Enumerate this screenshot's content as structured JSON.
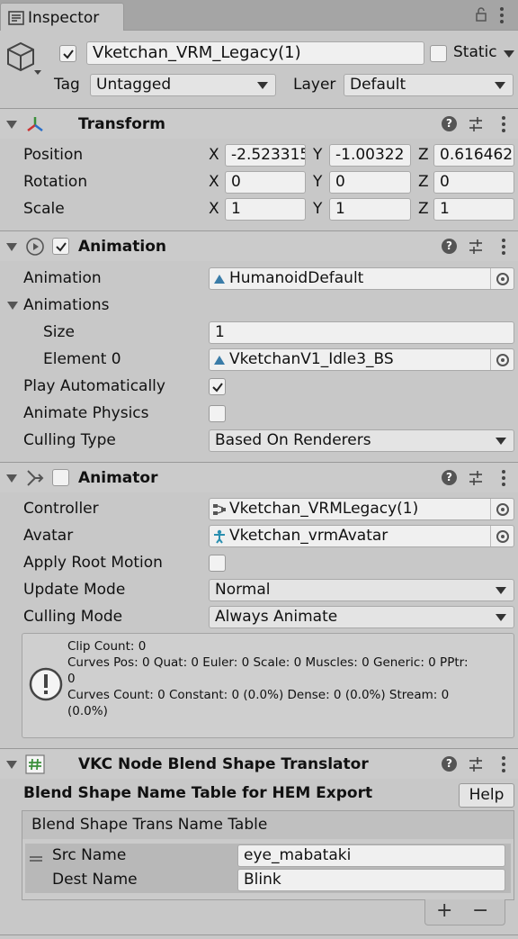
{
  "window": {
    "tab_title": "Inspector"
  },
  "object": {
    "active": true,
    "name": "Vketchan_VRM_Legacy(1)",
    "static_label": "Static",
    "tag_label": "Tag",
    "tag_value": "Untagged",
    "layer_label": "Layer",
    "layer_value": "Default"
  },
  "transform": {
    "title": "Transform",
    "rows": [
      {
        "label": "Position",
        "x": "-2.523315",
        "y": "-1.00322",
        "z": "0.616462"
      },
      {
        "label": "Rotation",
        "x": "0",
        "y": "0",
        "z": "0"
      },
      {
        "label": "Scale",
        "x": "1",
        "y": "1",
        "z": "1"
      }
    ],
    "axis": {
      "x": "X",
      "y": "Y",
      "z": "Z"
    }
  },
  "animation": {
    "title": "Animation",
    "enabled": true,
    "animation_label": "Animation",
    "animation_value": "HumanoidDefault",
    "animations_label": "Animations",
    "size_label": "Size",
    "size_value": "1",
    "element0_label": "Element 0",
    "element0_value": "VketchanV1_Idle3_BS",
    "play_auto_label": "Play Automatically",
    "play_auto": true,
    "animate_physics_label": "Animate Physics",
    "animate_physics": false,
    "culling_label": "Culling Type",
    "culling_value": "Based On Renderers"
  },
  "animator": {
    "title": "Animator",
    "enabled": false,
    "controller_label": "Controller",
    "controller_value": "Vketchan_VRMLegacy(1)",
    "avatar_label": "Avatar",
    "avatar_value": "Vketchan_vrmAvatar",
    "root_motion_label": "Apply Root Motion",
    "root_motion": false,
    "update_mode_label": "Update Mode",
    "update_mode_value": "Normal",
    "culling_mode_label": "Culling Mode",
    "culling_mode_value": "Always Animate",
    "info_line1": "Clip Count: 0",
    "info_line2": "Curves Pos: 0 Quat: 0 Euler: 0 Scale: 0 Muscles: 0 Generic: 0 PPtr:",
    "info_line3": "0",
    "info_line4": "Curves Count: 0 Constant: 0 (0.0%) Dense: 0 (0.0%) Stream: 0",
    "info_line5": "(0.0%)"
  },
  "vkc": {
    "title": "VKC Node Blend Shape Translator",
    "heading": "Blend Shape Name Table for HEM Export",
    "help_button": "Help",
    "table_title": "Blend Shape Trans Name Table",
    "src_label": "Src Name",
    "src_value": "eye_mabataki",
    "dest_label": "Dest Name",
    "dest_value": "Blink",
    "add_button": "+",
    "remove_button": "−"
  },
  "colors": {
    "panel_bg": "#c8c8c8",
    "field_bg": "#f0f0f0",
    "header_bg": "#cbcbcb"
  }
}
